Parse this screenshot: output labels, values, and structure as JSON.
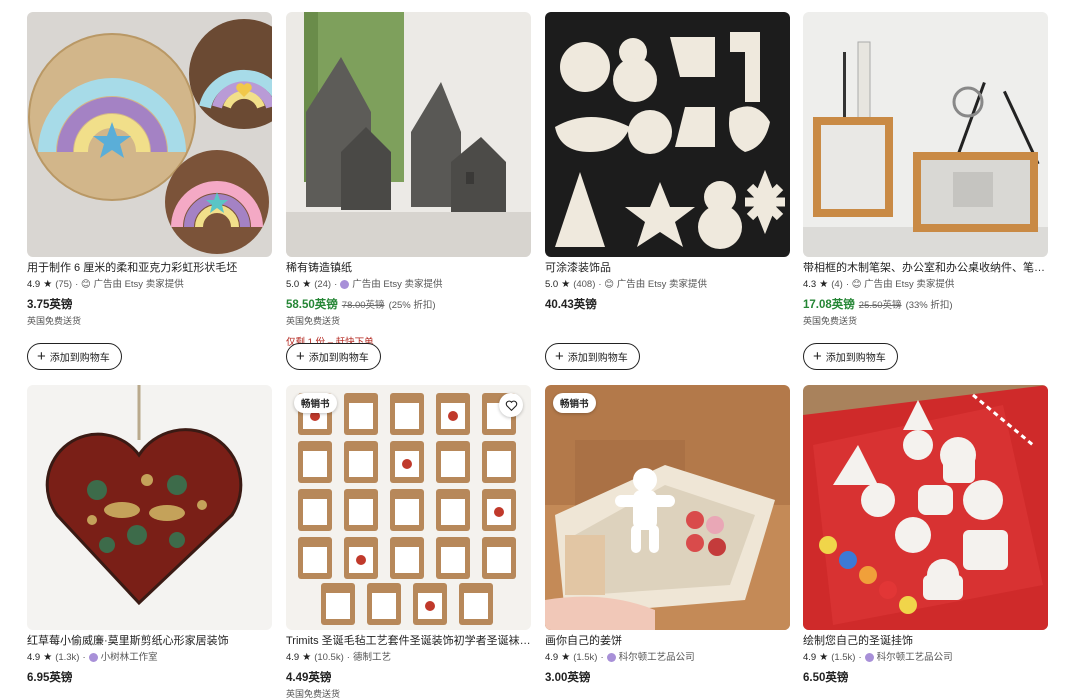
{
  "colors": {
    "sale_price": "#258635",
    "urgent": "#b3261e",
    "shop_badge": "#a890d8"
  },
  "row1": [
    {
      "title": "用于制作 6 厘米的柔和亚克力彩虹形状毛坯",
      "rating": "4.9",
      "reviews": "(75)",
      "seller": "· 😊 广告由 Etsy 卖家提供",
      "price": "3.75英镑",
      "shipping": "英国免费送货",
      "cart": "添加到购物车"
    },
    {
      "title": "稀有铸造镇纸",
      "rating": "5.0",
      "reviews": "(24)",
      "seller": "广告由 Etsy 卖家提供",
      "price": "58.50英镑",
      "original_price": "78.00英镑",
      "discount": "(25% 折扣)",
      "shipping": "英国免费送货",
      "urgency": "仅剩 1 份 – 赶快下单",
      "cart": "添加到购物车"
    },
    {
      "title": "可涂漆装饰品",
      "rating": "5.0",
      "reviews": "(408)",
      "seller": "· 😊 广告由 Etsy 卖家提供",
      "price": "40.43英镑",
      "cart": "添加到购物车"
    },
    {
      "title": "带相框的木制笔架、办公室和办公桌收纳件、笔架...",
      "rating": "4.3",
      "reviews": "(4)",
      "seller": "· 😊 广告由 Etsy 卖家提供",
      "price": "17.08英镑",
      "original_price": "25.50英镑",
      "discount": "(33% 折扣)",
      "shipping": "英国免费送货",
      "cart": "添加到购物车"
    }
  ],
  "row2": [
    {
      "title": "红草莓小偷威廉·莫里斯剪纸心形家居装饰",
      "rating": "4.9",
      "reviews": "(1.3k)",
      "seller": "小树林工作室",
      "price": "6.95英镑"
    },
    {
      "badge": "畅销书",
      "title": "Trimits 圣诞毛毡工艺套件圣诞装饰初学者圣诞袜填...",
      "rating": "4.9",
      "reviews": "(10.5k)",
      "seller": "德制工艺",
      "price": "4.49英镑",
      "shipping": "英国免费送货"
    },
    {
      "badge": "畅销书",
      "title": "画你自己的姜饼",
      "rating": "4.9",
      "reviews": "(1.5k)",
      "seller": "科尔顿工艺品公司",
      "price": "3.00英镑"
    },
    {
      "title": "绘制您自己的圣诞挂饰",
      "rating": "4.9",
      "reviews": "(1.5k)",
      "seller": "科尔顿工艺品公司",
      "price": "6.50英镑"
    }
  ]
}
